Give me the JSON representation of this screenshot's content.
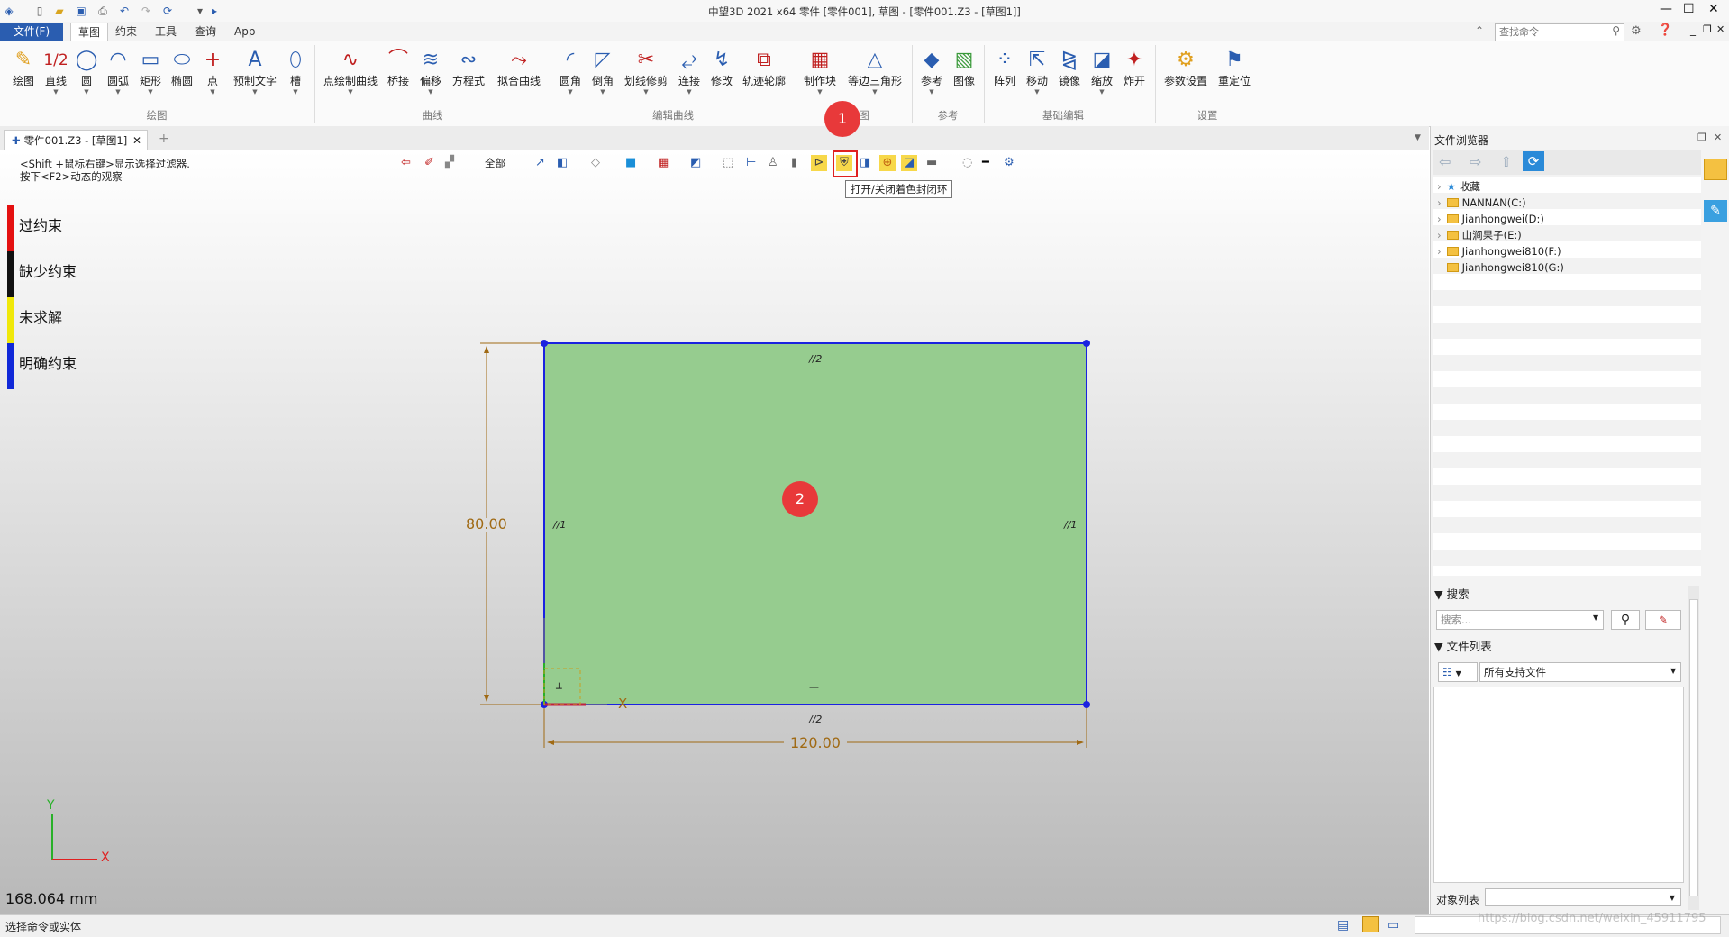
{
  "window": {
    "title": "中望3D 2021 x64       零件 [零件001], 草图 - [零件001.Z3 - [草图1]]"
  },
  "menu": {
    "file": "文件(F)",
    "tabs": [
      "草图",
      "约束",
      "工具",
      "查询",
      "App"
    ]
  },
  "search": {
    "placeholder": "查找命令"
  },
  "ribbon": {
    "groups": [
      "绘图",
      "曲线",
      "编辑曲线",
      "图",
      "参考",
      "基础编辑",
      "设置"
    ],
    "buttons": [
      "绘图",
      "直线",
      "圆",
      "圆弧",
      "矩形",
      "椭圆",
      "点",
      "预制文字",
      "槽",
      "点绘制曲线",
      "桥接",
      "偏移",
      "方程式",
      "拟合曲线",
      "圆角",
      "倒角",
      "划线修剪",
      "连接",
      "修改",
      "轨迹轮廓",
      "制作块",
      "等边三角形",
      "参考",
      "图像",
      "阵列",
      "移动",
      "镜像",
      "缩放",
      "炸开",
      "参数设置",
      "重定位"
    ],
    "line_sublabel": "1/2"
  },
  "doc_tab": {
    "label": "零件001.Z3 - [草图1]"
  },
  "viewport": {
    "hint_line1": "<Shift +鼠标右键>显示选择过滤器.",
    "hint_line2": "按下<F2>动态的观察",
    "filter_label": "全部",
    "legend": [
      {
        "label": "过约束",
        "color": "#e41010"
      },
      {
        "label": "缺少约束",
        "color": "#111111"
      },
      {
        "label": "未求解",
        "color": "#f0e80a"
      },
      {
        "label": "明确约束",
        "color": "#1028d8"
      }
    ],
    "tooltip": "打开/关闭着色封闭环",
    "badge1": "1",
    "badge2": "2",
    "dim_height": "80.00",
    "dim_width": "120.00",
    "constraint_top": "//2",
    "constraint_bottom": "//2",
    "constraint_left": "//1",
    "constraint_right": "//1",
    "horizontal_mark": "—",
    "origin_mark": "┴",
    "axis_x": "X",
    "axis_y": "Y",
    "scale_readout": "168.064 mm",
    "fill_color": "#96cc8f",
    "edge_color": "#1a22e0",
    "dim_color": "#a06a14"
  },
  "panel": {
    "title": "文件浏览器",
    "tree": [
      "收藏",
      "NANNAN(C:)",
      "Jianhongwei(D:)",
      "山涧果子(E:)",
      "Jianhongwei810(F:)",
      "Jianhongwei810(G:)"
    ],
    "search_header": "搜索",
    "search_placeholder": "搜索...",
    "file_list_header": "文件列表",
    "file_filter": "所有支持文件",
    "object_list_label": "对象列表"
  },
  "status": {
    "text": "选择命令或实体",
    "watermark": "https://blog.csdn.net/weixin_45911795"
  }
}
